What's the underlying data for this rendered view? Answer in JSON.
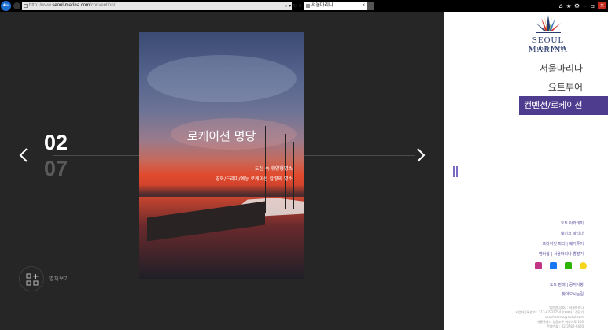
{
  "browser": {
    "url_prefix": "http://www.",
    "url_domain": "seoul-marina.com",
    "url_path": "/convention/",
    "addr_buttons": "⌕ ▾ ↻ ×",
    "tab_title": "서울마리나",
    "tab_close": "×",
    "window_controls": [
      "⌂",
      "★",
      "⚙",
      "–",
      "▫",
      "×"
    ]
  },
  "slider": {
    "current": "02",
    "total": "07",
    "title": "로케이션 명당",
    "desc_line1": "도심 속 휴양형명소",
    "desc_line2": "영화/드라마/예능 로케이션 촬영의 명소",
    "grid_label": "별처보기"
  },
  "logo": {
    "name": "SEOUL MARINA",
    "sub": "Club & Yacht"
  },
  "menu": {
    "items": [
      "서울마리나",
      "요트투어"
    ],
    "active": "컨벤션/로케이션"
  },
  "links": [
    "요트 아카데미",
    "웨이크 파티나",
    "프라이빗 파티 | 웨기투어",
    "멤버쉽 | 서울마리나 뽕팔기"
  ],
  "links2": [
    "요트 판매 | 공지사항",
    "찾아오시는길"
  ],
  "footer": [
    "법인명(상호) : 서울마리나",
    "사업자등록번호 : 213-87-32754 (대표자 : 정진기",
    "seoulmarina@seoul.com",
    "서울특별시 영등포구 여의서로 160",
    "전화번호 : 02-3780-9400"
  ],
  "colors": {
    "accent": "#4e3d8f",
    "instagram": "#c13584",
    "facebook": "#1877f2",
    "blog": "#2db400",
    "kakao": "#f7d51d"
  }
}
